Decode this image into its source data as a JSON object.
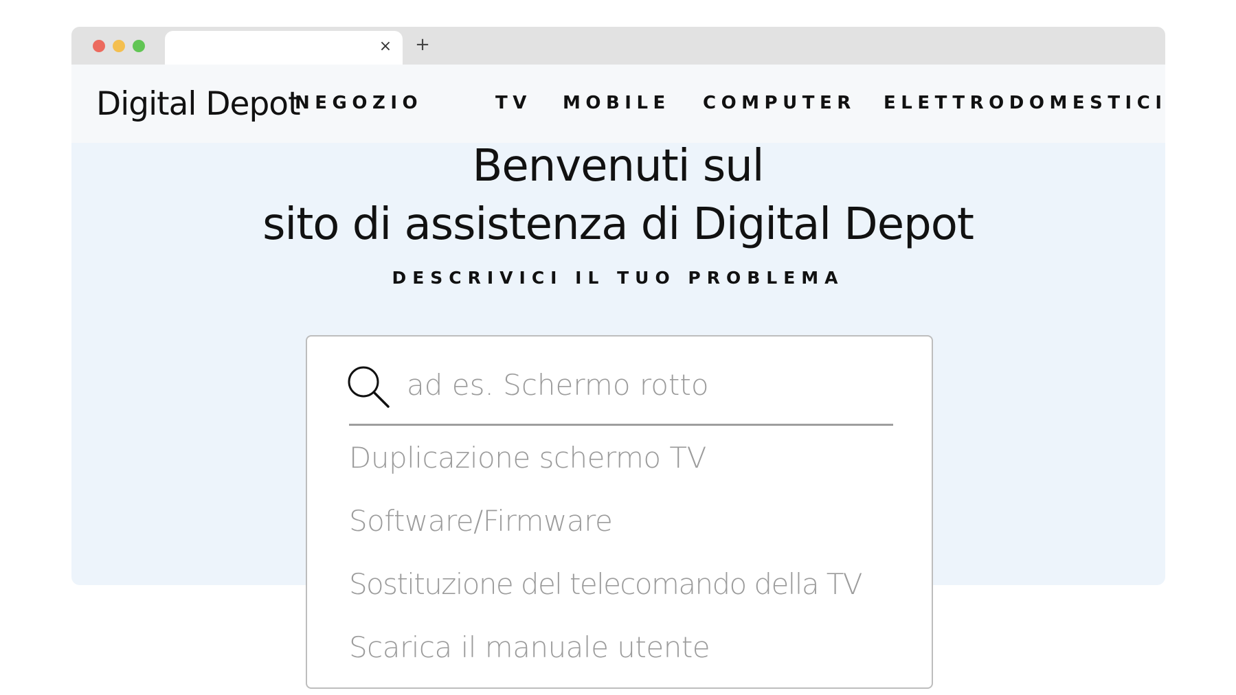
{
  "browser": {
    "tab_close_glyph": "×",
    "new_tab_glyph": "+"
  },
  "header": {
    "logo": "Digital Depot",
    "nav": [
      {
        "label": "NEGOZIO"
      },
      {
        "label": "TV"
      },
      {
        "label": "MOBILE"
      },
      {
        "label": "COMPUTER"
      },
      {
        "label": "ELETTRODOMESTICI"
      }
    ]
  },
  "hero": {
    "title_line1": "Benvenuti sul",
    "title_line2": "sito di assistenza di Digital Depot",
    "subtitle": "DESCRIVICI IL TUO PROBLEMA"
  },
  "search": {
    "icon": "search-icon",
    "placeholder": "ad es. Schermo rotto",
    "value": "",
    "suggestions": [
      {
        "label": "Duplicazione schermo TV"
      },
      {
        "label": "Software/Firmware"
      },
      {
        "label": "Sostituzione del telecomando della TV"
      },
      {
        "label": "Scarica il manuale utente"
      }
    ]
  },
  "colors": {
    "hero_bg": "#edf4fb",
    "nav_bg": "#f6f8fa",
    "tabbar_bg": "#e2e2e2",
    "traffic_red": "#ec6a5e",
    "traffic_yellow": "#f4bf4f",
    "traffic_green": "#61c554",
    "suggestion_text": "#9b9b9b"
  }
}
